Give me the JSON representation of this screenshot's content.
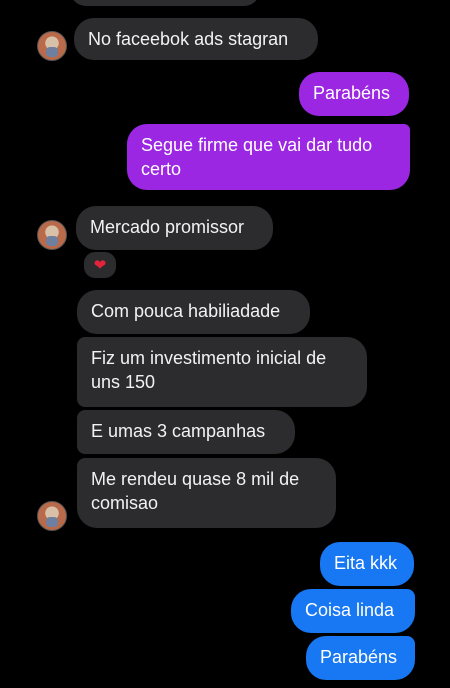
{
  "messages": [
    {
      "text": "No faceebok ads stagran"
    },
    {
      "text": "Parabéns"
    },
    {
      "text": "Segue firme que vai dar tudo certo"
    },
    {
      "text": "Mercado promissor"
    },
    {
      "text": "Com pouca habiliadade"
    },
    {
      "text": "Fiz um investimento inicial de uns 150"
    },
    {
      "text": "E umas 3 campanhas"
    },
    {
      "text": "Me rendeu quase 8 mil de comisao"
    },
    {
      "text": "Eita kkk"
    },
    {
      "text": "Coisa linda"
    },
    {
      "text": "Parabéns"
    }
  ],
  "reaction": {
    "icon": "heart-icon",
    "glyph": "❤"
  },
  "colors": {
    "incoming": "#2c2c2e",
    "outgoing_purple": "#9b27e3",
    "outgoing_blue": "#1877f2",
    "background": "#000000"
  }
}
